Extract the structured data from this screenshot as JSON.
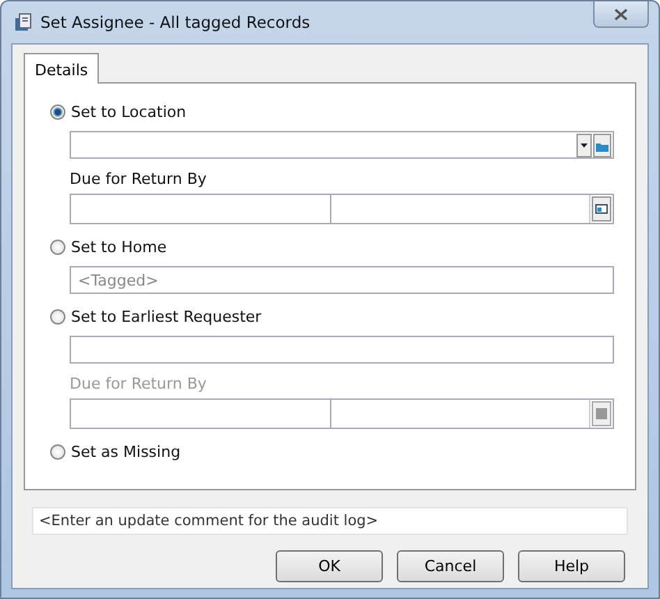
{
  "window": {
    "title": "Set Assignee - All tagged Records"
  },
  "tabs": [
    {
      "label": "Details",
      "selected": true
    }
  ],
  "options": [
    {
      "kind": "location",
      "label": "Set to Location",
      "selected": true,
      "due_label": "Due for Return By",
      "disabled": false
    },
    {
      "kind": "home",
      "label": "Set to Home",
      "selected": false,
      "placeholder": "<Tagged>"
    },
    {
      "kind": "requester",
      "label": "Set to Earliest Requester",
      "selected": false,
      "due_label": "Due for Return By",
      "disabled": true
    },
    {
      "kind": "missing",
      "label": "Set as Missing",
      "selected": false
    }
  ],
  "comment": {
    "placeholder": "<Enter an update comment for the audit log>"
  },
  "buttons": [
    "OK",
    "Cancel",
    "Help"
  ]
}
